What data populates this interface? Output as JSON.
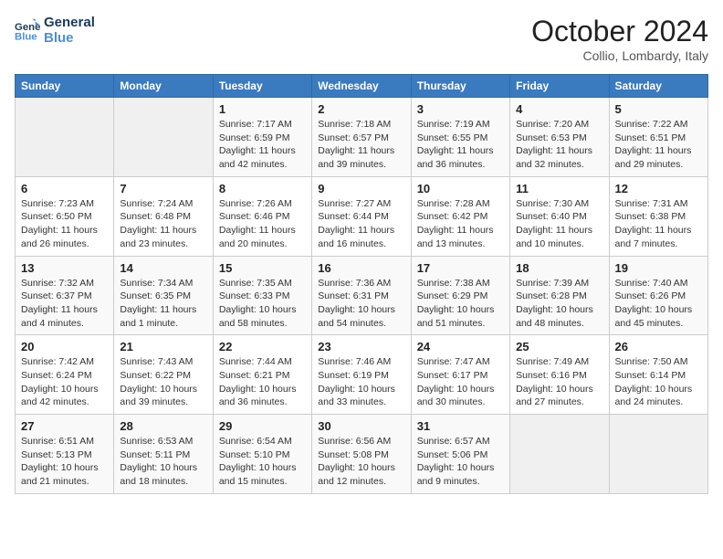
{
  "header": {
    "logo_line1": "General",
    "logo_line2": "Blue",
    "month": "October 2024",
    "location": "Collio, Lombardy, Italy"
  },
  "weekdays": [
    "Sunday",
    "Monday",
    "Tuesday",
    "Wednesday",
    "Thursday",
    "Friday",
    "Saturday"
  ],
  "weeks": [
    [
      {
        "day": "",
        "detail": ""
      },
      {
        "day": "",
        "detail": ""
      },
      {
        "day": "1",
        "detail": "Sunrise: 7:17 AM\nSunset: 6:59 PM\nDaylight: 11 hours and 42 minutes."
      },
      {
        "day": "2",
        "detail": "Sunrise: 7:18 AM\nSunset: 6:57 PM\nDaylight: 11 hours and 39 minutes."
      },
      {
        "day": "3",
        "detail": "Sunrise: 7:19 AM\nSunset: 6:55 PM\nDaylight: 11 hours and 36 minutes."
      },
      {
        "day": "4",
        "detail": "Sunrise: 7:20 AM\nSunset: 6:53 PM\nDaylight: 11 hours and 32 minutes."
      },
      {
        "day": "5",
        "detail": "Sunrise: 7:22 AM\nSunset: 6:51 PM\nDaylight: 11 hours and 29 minutes."
      }
    ],
    [
      {
        "day": "6",
        "detail": "Sunrise: 7:23 AM\nSunset: 6:50 PM\nDaylight: 11 hours and 26 minutes."
      },
      {
        "day": "7",
        "detail": "Sunrise: 7:24 AM\nSunset: 6:48 PM\nDaylight: 11 hours and 23 minutes."
      },
      {
        "day": "8",
        "detail": "Sunrise: 7:26 AM\nSunset: 6:46 PM\nDaylight: 11 hours and 20 minutes."
      },
      {
        "day": "9",
        "detail": "Sunrise: 7:27 AM\nSunset: 6:44 PM\nDaylight: 11 hours and 16 minutes."
      },
      {
        "day": "10",
        "detail": "Sunrise: 7:28 AM\nSunset: 6:42 PM\nDaylight: 11 hours and 13 minutes."
      },
      {
        "day": "11",
        "detail": "Sunrise: 7:30 AM\nSunset: 6:40 PM\nDaylight: 11 hours and 10 minutes."
      },
      {
        "day": "12",
        "detail": "Sunrise: 7:31 AM\nSunset: 6:38 PM\nDaylight: 11 hours and 7 minutes."
      }
    ],
    [
      {
        "day": "13",
        "detail": "Sunrise: 7:32 AM\nSunset: 6:37 PM\nDaylight: 11 hours and 4 minutes."
      },
      {
        "day": "14",
        "detail": "Sunrise: 7:34 AM\nSunset: 6:35 PM\nDaylight: 11 hours and 1 minute."
      },
      {
        "day": "15",
        "detail": "Sunrise: 7:35 AM\nSunset: 6:33 PM\nDaylight: 10 hours and 58 minutes."
      },
      {
        "day": "16",
        "detail": "Sunrise: 7:36 AM\nSunset: 6:31 PM\nDaylight: 10 hours and 54 minutes."
      },
      {
        "day": "17",
        "detail": "Sunrise: 7:38 AM\nSunset: 6:29 PM\nDaylight: 10 hours and 51 minutes."
      },
      {
        "day": "18",
        "detail": "Sunrise: 7:39 AM\nSunset: 6:28 PM\nDaylight: 10 hours and 48 minutes."
      },
      {
        "day": "19",
        "detail": "Sunrise: 7:40 AM\nSunset: 6:26 PM\nDaylight: 10 hours and 45 minutes."
      }
    ],
    [
      {
        "day": "20",
        "detail": "Sunrise: 7:42 AM\nSunset: 6:24 PM\nDaylight: 10 hours and 42 minutes."
      },
      {
        "day": "21",
        "detail": "Sunrise: 7:43 AM\nSunset: 6:22 PM\nDaylight: 10 hours and 39 minutes."
      },
      {
        "day": "22",
        "detail": "Sunrise: 7:44 AM\nSunset: 6:21 PM\nDaylight: 10 hours and 36 minutes."
      },
      {
        "day": "23",
        "detail": "Sunrise: 7:46 AM\nSunset: 6:19 PM\nDaylight: 10 hours and 33 minutes."
      },
      {
        "day": "24",
        "detail": "Sunrise: 7:47 AM\nSunset: 6:17 PM\nDaylight: 10 hours and 30 minutes."
      },
      {
        "day": "25",
        "detail": "Sunrise: 7:49 AM\nSunset: 6:16 PM\nDaylight: 10 hours and 27 minutes."
      },
      {
        "day": "26",
        "detail": "Sunrise: 7:50 AM\nSunset: 6:14 PM\nDaylight: 10 hours and 24 minutes."
      }
    ],
    [
      {
        "day": "27",
        "detail": "Sunrise: 6:51 AM\nSunset: 5:13 PM\nDaylight: 10 hours and 21 minutes."
      },
      {
        "day": "28",
        "detail": "Sunrise: 6:53 AM\nSunset: 5:11 PM\nDaylight: 10 hours and 18 minutes."
      },
      {
        "day": "29",
        "detail": "Sunrise: 6:54 AM\nSunset: 5:10 PM\nDaylight: 10 hours and 15 minutes."
      },
      {
        "day": "30",
        "detail": "Sunrise: 6:56 AM\nSunset: 5:08 PM\nDaylight: 10 hours and 12 minutes."
      },
      {
        "day": "31",
        "detail": "Sunrise: 6:57 AM\nSunset: 5:06 PM\nDaylight: 10 hours and 9 minutes."
      },
      {
        "day": "",
        "detail": ""
      },
      {
        "day": "",
        "detail": ""
      }
    ]
  ]
}
